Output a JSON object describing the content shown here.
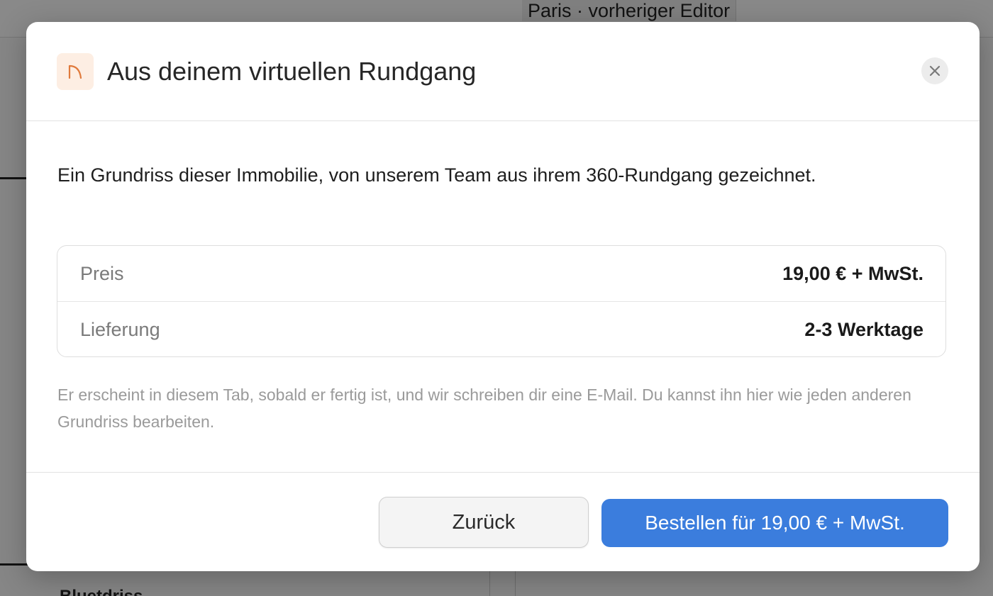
{
  "background": {
    "editor_label": "Paris · vorheriger Editor",
    "section_heading": "Bluetdriss"
  },
  "modal": {
    "icon": "floorplan-arc-icon",
    "title": "Aus deinem virtuellen Rundgang",
    "close_icon": "close-icon",
    "lead": "Ein Grundriss dieser Immobilie, von unserem Team aus ihrem 360-Rundgang gezeichnet.",
    "details": [
      {
        "label": "Preis",
        "value": "19,00 € + MwSt."
      },
      {
        "label": "Lieferung",
        "value": "2-3 Werktage"
      }
    ],
    "note": "Er erscheint in diesem Tab, sobald er fertig ist, und wir schreiben dir eine E-Mail. Du kannst ihn hier wie jeden anderen Grundriss bearbeiten.",
    "buttons": {
      "back": "Zurück",
      "order": "Bestellen für 19,00 € + MwSt."
    }
  },
  "colors": {
    "accent": "#3b7ddd",
    "icon_tint": "#e07a3c",
    "icon_bg": "#fdeee3"
  }
}
